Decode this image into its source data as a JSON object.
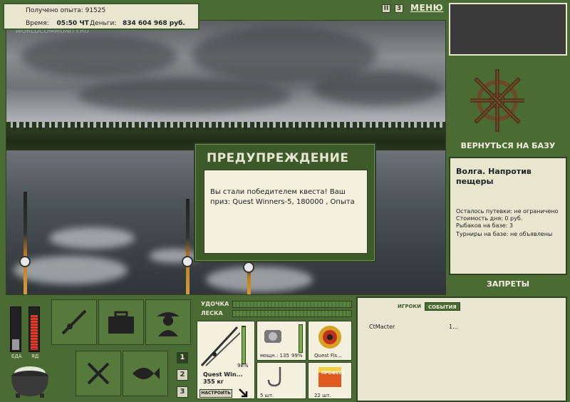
{
  "info": {
    "experience_label": "Получено опыта: 91525",
    "time_label": "Время:",
    "time_value": "05:50 ЧТ",
    "money_label": "Деньги:",
    "money_value": "834 604 968 руб."
  },
  "top_buttons": {
    "pause": "II",
    "third": "3",
    "menu": "МЕНЮ"
  },
  "watermark": "WORLDCOMMUNITY.RU",
  "right_panel": {
    "return": "ВЕРНУТЬСЯ НА БАЗУ",
    "location": "Волга. Напротив пещеры",
    "lines": [
      "Осталось путевки: не ограничено",
      "Стоимость дня: 0 руб.",
      "Рыбаков на базе: 3",
      "Турниры на базе: не объявлены"
    ],
    "bans": "ЗАПРЕТЫ"
  },
  "dialog": {
    "title": "ПРЕДУПРЕЖДЕНИЕ",
    "message": "Вы стали победителем квеста! Ваш приз: Quest Winners-5, 180000 , Опыта"
  },
  "gauges": {
    "food_label": "ЕДА",
    "poison_label": "ЯД",
    "food_level": 0.25,
    "poison_level": 0.85
  },
  "pages": [
    "1",
    "2",
    "3"
  ],
  "tackle": {
    "rod_label": "УДОЧКА",
    "line_label": "ЛЕСКА",
    "rod_name": "Quest Win...",
    "rod_weight": "355 кг",
    "rod_pct": "98%",
    "reel_power": "мощн.: 135",
    "reel_pct": "99%",
    "line_name": "Quest Fis...",
    "hooks_count": "5 шт.",
    "bait_count": "22 шт.",
    "setup": "НАСТРОИТЬ",
    "rod_level": 0.98,
    "reel_level": 0.99,
    "bait_brand": "ПРОФЕСС"
  },
  "players": {
    "tab_players": "ИГРОКИ",
    "tab_events": "СОБЫТИЯ",
    "rows": [
      {
        "name": "CtMacter",
        "value": "1..."
      }
    ]
  },
  "colors": {
    "panel_green": "#4a6b33",
    "dark_green": "#2c4220",
    "cream": "#e8e6cf"
  }
}
